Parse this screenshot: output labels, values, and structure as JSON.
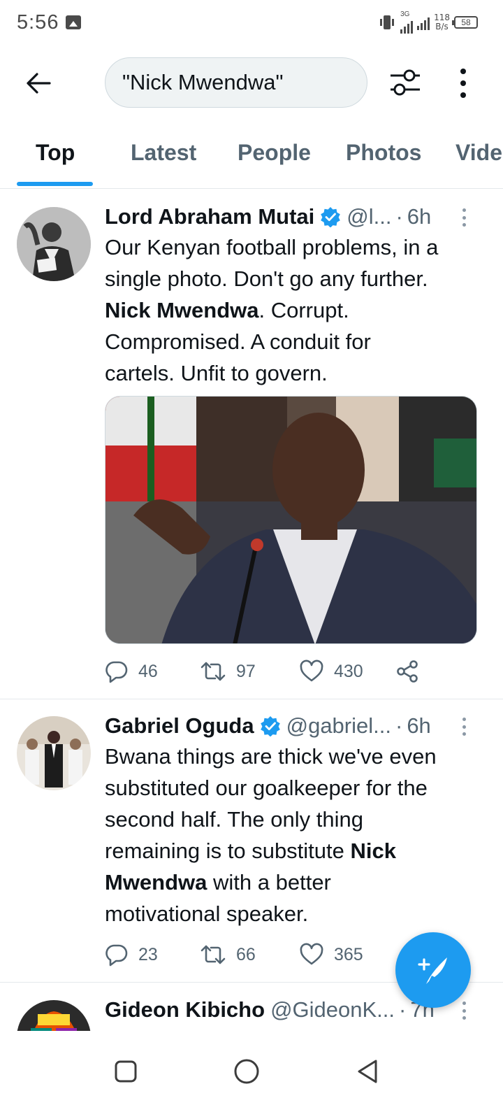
{
  "status_bar": {
    "time": "5:56",
    "network_type": "3G",
    "speed_value": "118",
    "speed_unit": "B/s",
    "battery": "58"
  },
  "header": {
    "search_query": "\"Nick Mwendwa\""
  },
  "tabs": [
    {
      "label": "Top",
      "active": true
    },
    {
      "label": "Latest",
      "active": false
    },
    {
      "label": "People",
      "active": false
    },
    {
      "label": "Photos",
      "active": false
    },
    {
      "label": "Vide",
      "active": false
    }
  ],
  "tweets": [
    {
      "name": "Lord Abraham Mutai",
      "verified": true,
      "handle": "@l...",
      "time": "6h",
      "text_lines": [
        "Our Kenyan football problems, in a",
        "single photo. Don't go any further."
      ],
      "text_bold": "Nick Mwendwa",
      "text_after_bold": ". Corrupt.",
      "text_tail": [
        "Compromised. A conduit for",
        "cartels. Unfit to govern."
      ],
      "replies": "46",
      "retweets": "97",
      "likes": "430"
    },
    {
      "name": "Gabriel Oguda",
      "verified": true,
      "handle": "@gabriel...",
      "time": "6h",
      "text_lines": [
        "Bwana things are thick we've even",
        "substituted our goalkeeper for the",
        "second half. The only thing"
      ],
      "text_line4_pre": "remaining is to substitute ",
      "text_line4_bold": "Nick",
      "text_line5_bold": "Mwendwa",
      "text_line5_post": " with a better",
      "text_line6": "motivational speaker.",
      "replies": "23",
      "retweets": "66",
      "likes": "365"
    },
    {
      "name": "Gideon Kibicho",
      "handle": "@GideonK...",
      "time": "7h"
    }
  ],
  "colors": {
    "accent": "#1d9bf0",
    "text_primary": "#0f1419",
    "text_secondary": "#536471"
  },
  "icons": [
    "back-arrow-icon",
    "filter-icon",
    "more-vertical-icon",
    "verified-icon",
    "reply-icon",
    "retweet-icon",
    "like-icon",
    "share-icon",
    "compose-icon",
    "recents-icon",
    "home-icon",
    "nav-back-icon"
  ]
}
